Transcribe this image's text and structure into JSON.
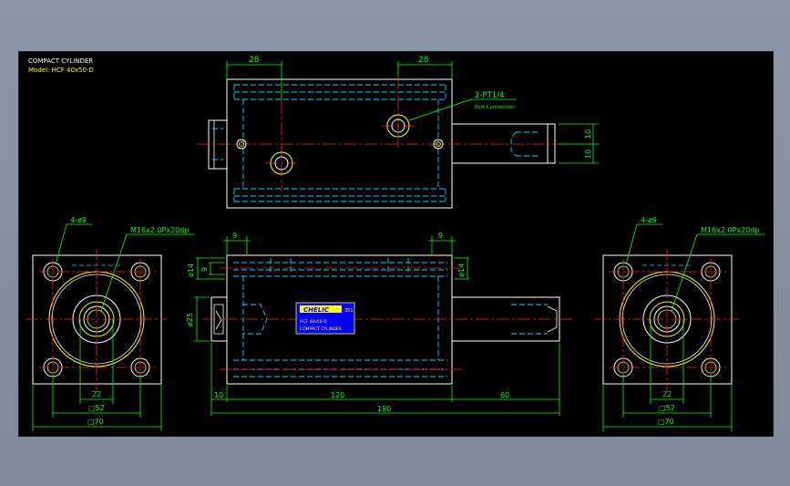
{
  "title_block": {
    "title": "COMPACT CYLINDER",
    "model": "Model: HCF 40x50-D"
  },
  "labels": {
    "top_dim_left": "28",
    "top_dim_right": "28",
    "port_label": "2-PT1/4",
    "port_sub": "Port Connection",
    "dim_10_a": "10",
    "dim_10_b": "10",
    "left_holes": "4-ø9",
    "left_thread": "M16x2.0Px20dp",
    "right_holes": "4-ø9",
    "right_thread": "M16x2.0Px20dp",
    "dim_9_left": "9",
    "dim_9_right": "9",
    "dim_phi14_left": "ø14",
    "dim_phi14_right": "ø14",
    "dim_9_vert": "9",
    "dim_phi25": "ø25",
    "dim_10": "10",
    "dim_120": "120",
    "dim_60": "60",
    "dim_190": "190",
    "left_22": "22",
    "left_52": "□52",
    "left_70": "□70",
    "right_22": "22",
    "right_52": "□52",
    "right_70": "□70"
  },
  "nameplate": {
    "brand": "CHELIC",
    "code": "351",
    "model_line": "HCF 40x50-D",
    "name_line": "COMPACT CYLINDER"
  },
  "colors": {
    "outline": "#ffffff",
    "hidden": "#00d8ff",
    "center": "#ff2020",
    "dimension": "#00ff00",
    "highlight": "#ffff00",
    "nameplate_bg": "#0000ff",
    "nameplate_text": "#ffff00"
  }
}
